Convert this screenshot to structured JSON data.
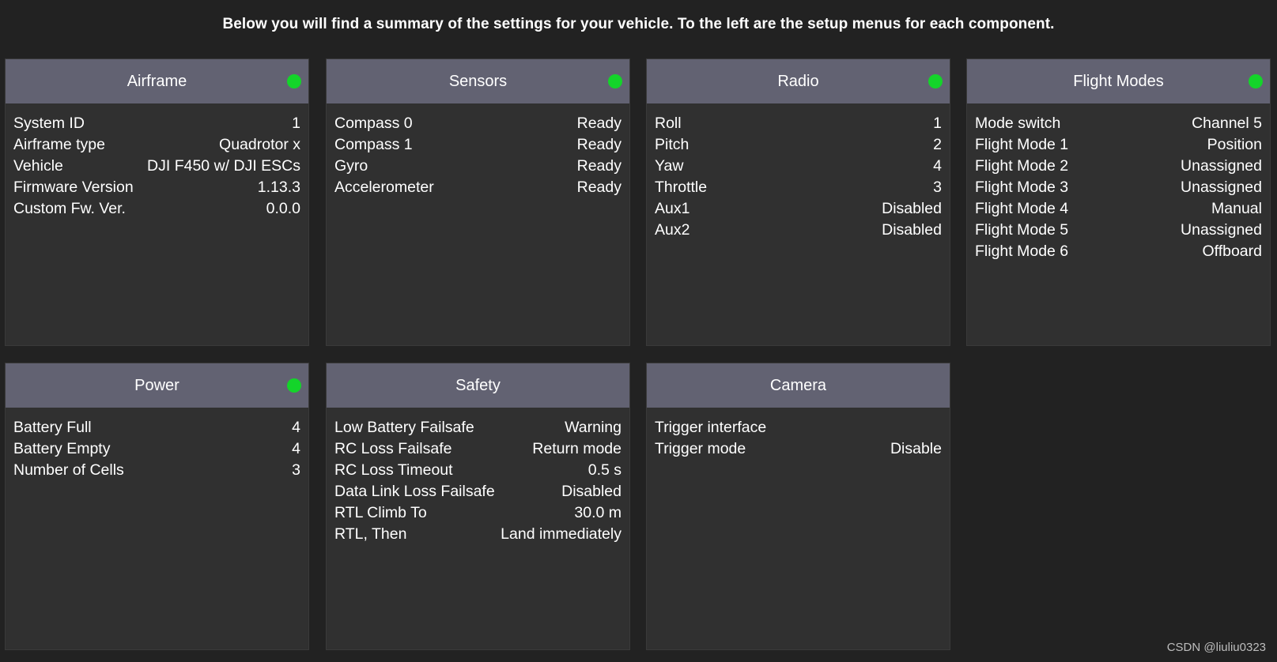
{
  "intro_text": "Below you will find a summary of the settings for your vehicle. To the left are the setup menus for each component.",
  "colors": {
    "background": "#222222",
    "panel_background": "#303030",
    "header_background": "#626272",
    "status_ok": "#14d42a",
    "text": "#ffffff"
  },
  "panels": [
    {
      "title": "Airframe",
      "status": "ok",
      "rows": [
        {
          "label": "System ID",
          "value": "1"
        },
        {
          "label": "Airframe type",
          "value": "Quadrotor x"
        },
        {
          "label": "Vehicle",
          "value": "DJI F450 w/ DJI ESCs"
        },
        {
          "label": "Firmware Version",
          "value": "1.13.3"
        },
        {
          "label": "Custom Fw. Ver.",
          "value": "0.0.0"
        }
      ]
    },
    {
      "title": "Sensors",
      "status": "ok",
      "rows": [
        {
          "label": "Compass 0",
          "value": "Ready"
        },
        {
          "label": "Compass 1",
          "value": "Ready"
        },
        {
          "label": "Gyro",
          "value": "Ready"
        },
        {
          "label": "Accelerometer",
          "value": "Ready"
        }
      ]
    },
    {
      "title": "Radio",
      "status": "ok",
      "rows": [
        {
          "label": "Roll",
          "value": "1"
        },
        {
          "label": "Pitch",
          "value": "2"
        },
        {
          "label": "Yaw",
          "value": "4"
        },
        {
          "label": "Throttle",
          "value": "3"
        },
        {
          "label": "Aux1",
          "value": "Disabled"
        },
        {
          "label": "Aux2",
          "value": "Disabled"
        }
      ]
    },
    {
      "title": "Flight Modes",
      "status": "ok",
      "rows": [
        {
          "label": "Mode switch",
          "value": "Channel 5"
        },
        {
          "label": "Flight Mode 1",
          "value": "Position"
        },
        {
          "label": "Flight Mode 2",
          "value": "Unassigned"
        },
        {
          "label": "Flight Mode 3",
          "value": "Unassigned"
        },
        {
          "label": "Flight Mode 4",
          "value": "Manual"
        },
        {
          "label": "Flight Mode 5",
          "value": "Unassigned"
        },
        {
          "label": "Flight Mode 6",
          "value": "Offboard"
        }
      ]
    },
    {
      "title": "Power",
      "status": "ok",
      "rows": [
        {
          "label": "Battery Full",
          "value": "4"
        },
        {
          "label": "Battery Empty",
          "value": "4"
        },
        {
          "label": "Number of Cells",
          "value": "3"
        }
      ]
    },
    {
      "title": "Safety",
      "status": "none",
      "rows": [
        {
          "label": "Low Battery Failsafe",
          "value": "Warning"
        },
        {
          "label": "RC Loss Failsafe",
          "value": "Return mode"
        },
        {
          "label": "RC Loss Timeout",
          "value": "0.5 s"
        },
        {
          "label": "Data Link Loss Failsafe",
          "value": "Disabled"
        },
        {
          "label": "RTL Climb To",
          "value": "30.0 m"
        },
        {
          "label": "RTL, Then",
          "value": "Land immediately"
        }
      ]
    },
    {
      "title": "Camera",
      "status": "none",
      "rows": [
        {
          "label": "Trigger interface",
          "value": ""
        },
        {
          "label": "Trigger mode",
          "value": "Disable"
        }
      ]
    }
  ],
  "watermark": "CSDN @liuliu0323"
}
